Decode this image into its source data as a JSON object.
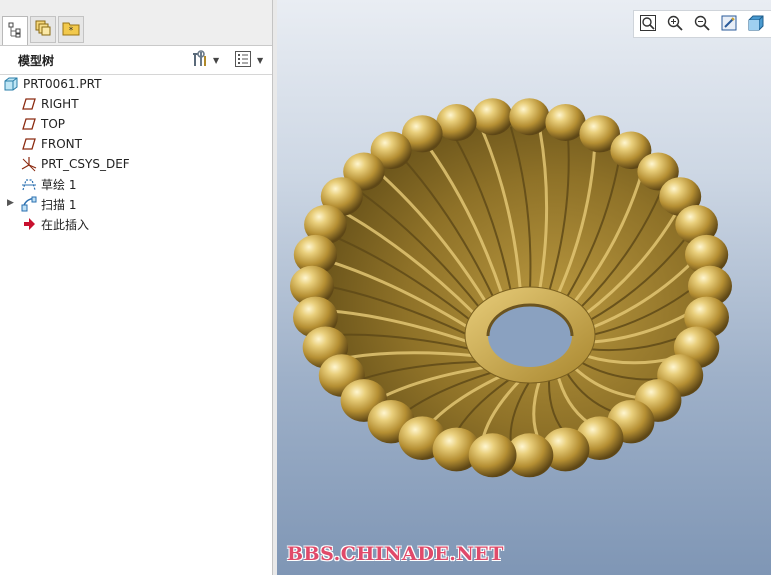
{
  "left_panel": {
    "tabs": [
      {
        "name": "model-tree-tab-icon",
        "active": true
      },
      {
        "name": "layers-tab-icon",
        "active": false
      },
      {
        "name": "favorites-folder-tab-icon",
        "active": false
      }
    ],
    "title": "模型树",
    "header_buttons": [
      {
        "icon": "settings-tools-icon",
        "has_dropdown": true
      },
      {
        "icon": "tree-columns-icon",
        "has_dropdown": true
      }
    ]
  },
  "model_tree": {
    "root": {
      "label": "PRT0061.PRT",
      "icon": "part-cube-icon"
    },
    "items": [
      {
        "label": "RIGHT",
        "icon": "datum-plane-icon"
      },
      {
        "label": "TOP",
        "icon": "datum-plane-icon"
      },
      {
        "label": "FRONT",
        "icon": "datum-plane-icon"
      },
      {
        "label": "PRT_CSYS_DEF",
        "icon": "coordinate-system-icon"
      },
      {
        "label": "草绘 1",
        "icon": "sketch-icon"
      },
      {
        "label": "扫描 1",
        "icon": "sweep-feature-icon",
        "expandable": true
      },
      {
        "label": "在此插入",
        "icon": "insert-here-arrow-icon"
      }
    ]
  },
  "view_toolbar": [
    {
      "icon": "refit-icon"
    },
    {
      "icon": "zoom-in-icon"
    },
    {
      "icon": "zoom-out-icon"
    },
    {
      "icon": "repaint-icon"
    },
    {
      "icon": "display-style-icon"
    }
  ],
  "colors": {
    "model_gold": "#c9a94f",
    "model_highlight": "#f3e4a6",
    "model_shadow": "#6b5420",
    "watermark": "#e04a6a",
    "insert_arrow": "#c8102e"
  },
  "watermark": "BBS.CHINADE.NET"
}
